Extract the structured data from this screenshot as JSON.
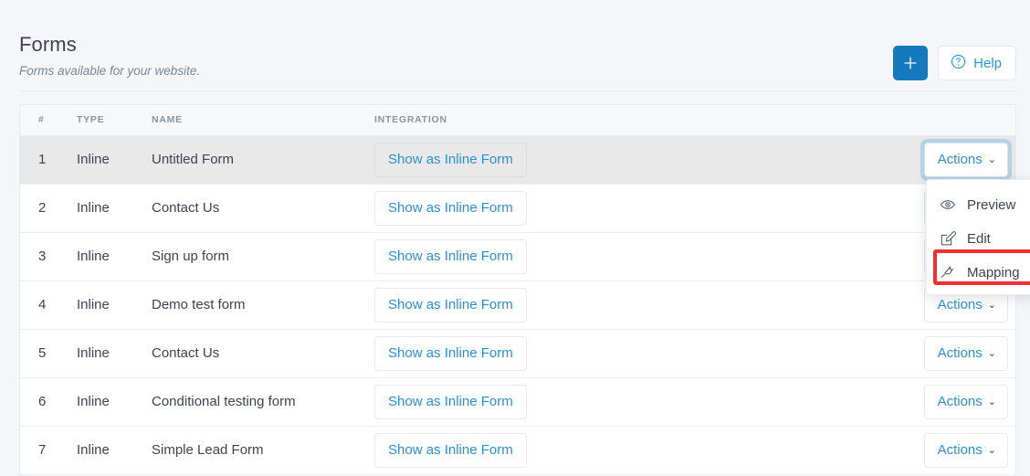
{
  "header": {
    "title": "Forms",
    "subtitle": "Forms available for your website.",
    "add_button": {
      "label": "+",
      "icon": "plus-icon",
      "color": "#1579bd"
    },
    "help_button": {
      "label": "Help",
      "icon": "question-circle-icon",
      "color": "#2a9ae0"
    }
  },
  "table": {
    "columns": [
      "#",
      "TYPE",
      "NAME",
      "INTEGRATION",
      ""
    ],
    "rows": [
      {
        "num": "1",
        "type": "Inline",
        "name": "Untitled Form",
        "integration": "Show as Inline Form",
        "actions": "Actions",
        "active": true
      },
      {
        "num": "2",
        "type": "Inline",
        "name": "Contact Us",
        "integration": "Show as Inline Form",
        "actions": "Actions",
        "active": false
      },
      {
        "num": "3",
        "type": "Inline",
        "name": "Sign up form",
        "integration": "Show as Inline Form",
        "actions": "Actions",
        "active": false
      },
      {
        "num": "4",
        "type": "Inline",
        "name": "Demo test form",
        "integration": "Show as Inline Form",
        "actions": "Actions",
        "active": false
      },
      {
        "num": "5",
        "type": "Inline",
        "name": "Contact Us",
        "integration": "Show as Inline Form",
        "actions": "Actions",
        "active": false
      },
      {
        "num": "6",
        "type": "Inline",
        "name": "Conditional testing form",
        "integration": "Show as Inline Form",
        "actions": "Actions",
        "active": false
      },
      {
        "num": "7",
        "type": "Inline",
        "name": "Simple Lead Form",
        "integration": "Show as Inline Form",
        "actions": "Actions",
        "active": false
      }
    ]
  },
  "dropdown": {
    "open": true,
    "caret": "⌄",
    "items": [
      {
        "label": "Preview",
        "icon": "eye-icon"
      },
      {
        "label": "Edit",
        "icon": "pencil-square-icon"
      },
      {
        "label": "Mapping",
        "icon": "plug-icon"
      }
    ]
  },
  "annotation": {
    "target": "Mapping",
    "color": "#f1312f"
  }
}
